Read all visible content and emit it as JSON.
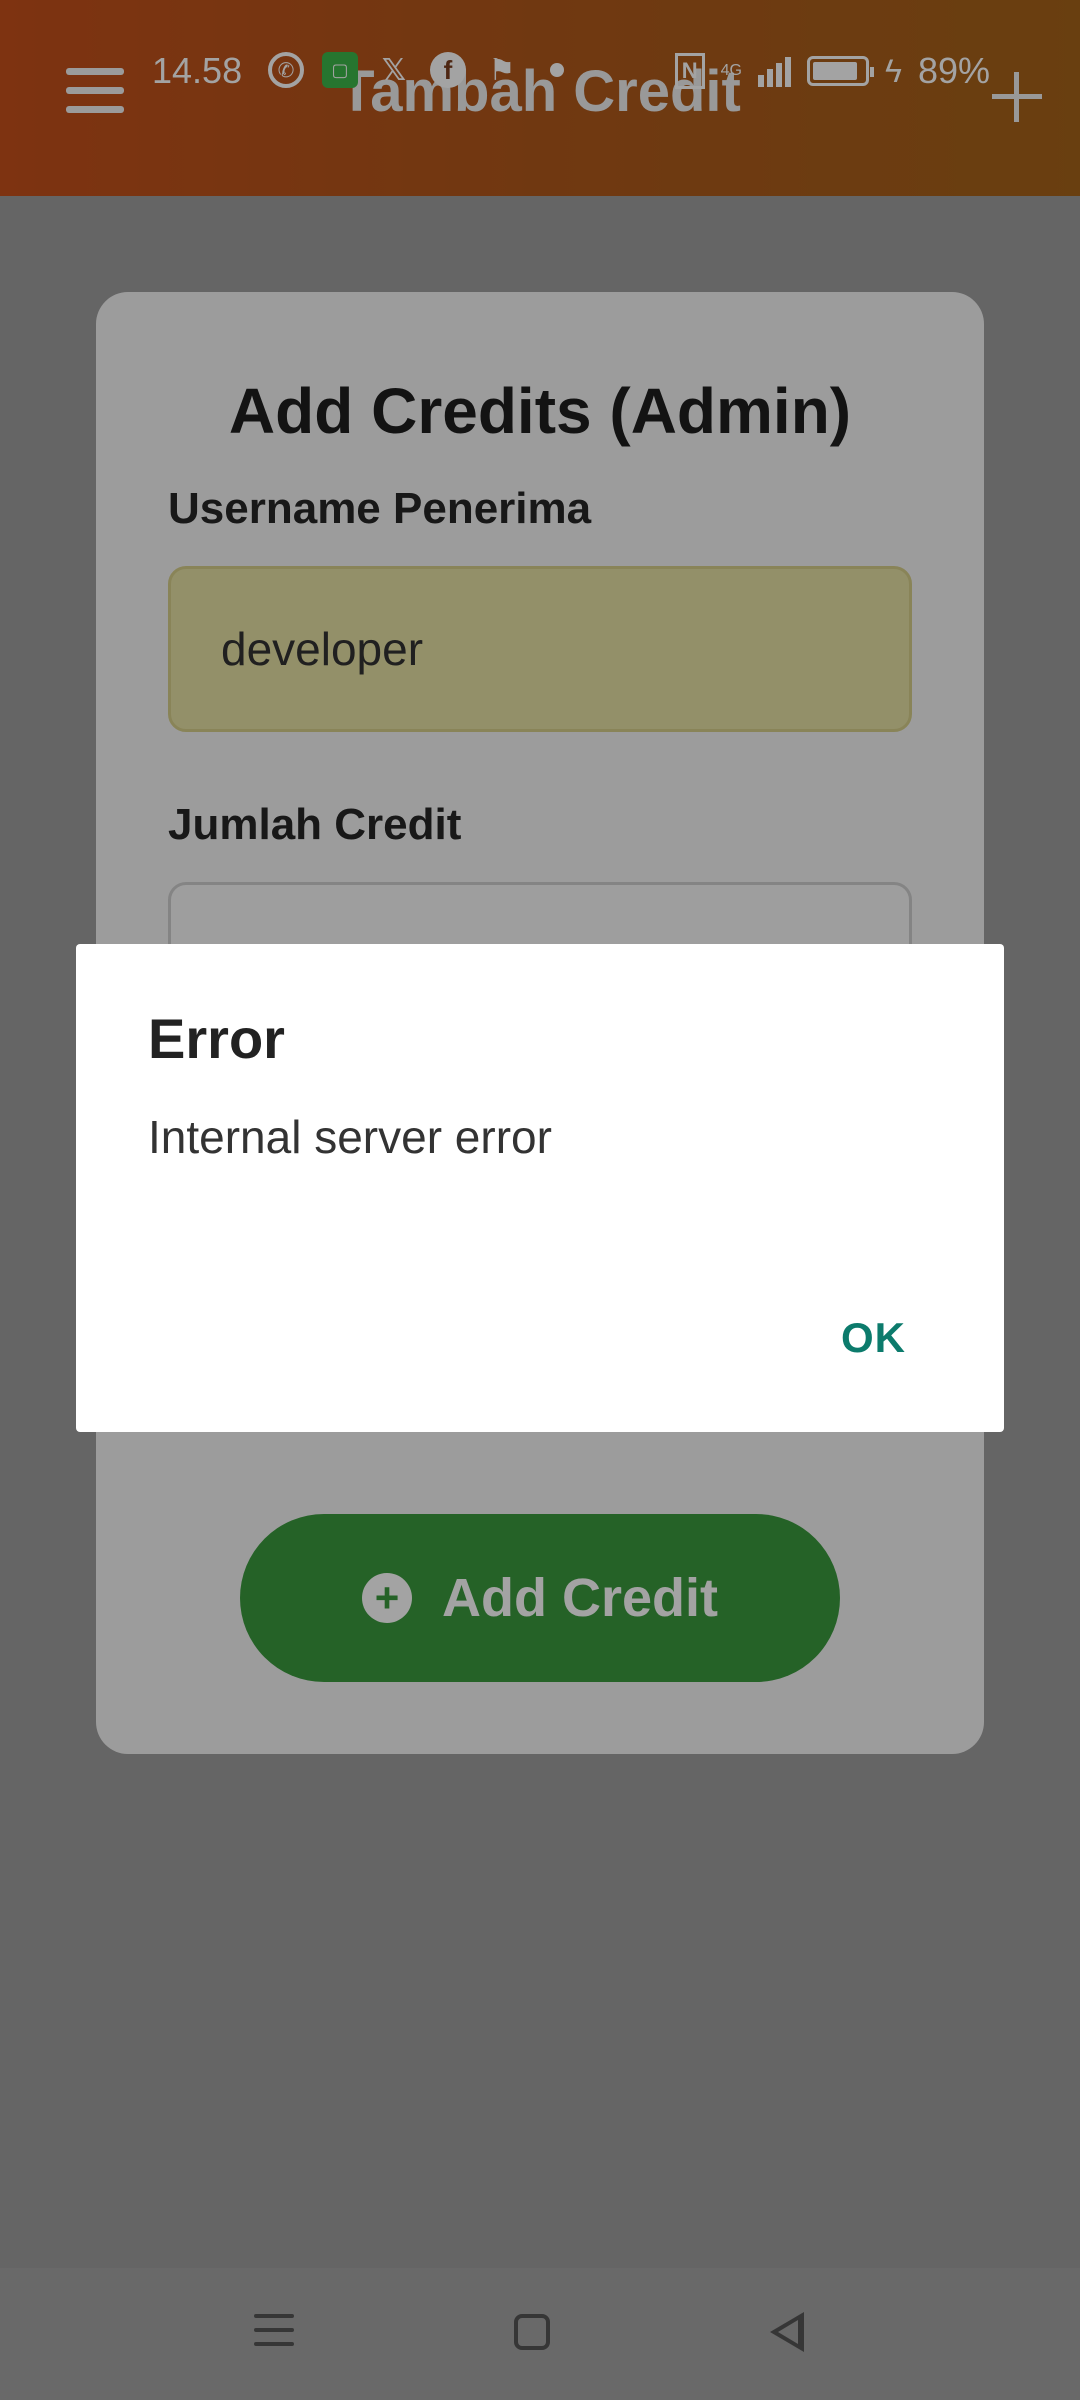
{
  "status_bar": {
    "time": "14.58",
    "battery": "89%",
    "network": "4G",
    "notification_icons": [
      "whatsapp-icon",
      "app-icon",
      "x-icon",
      "facebook-icon",
      "app-icon-2",
      "dot-icon"
    ]
  },
  "app_bar": {
    "title": "Tambah Credit",
    "menu_icon": "hamburger-menu-icon",
    "action_icon": "plus-icon"
  },
  "form": {
    "title": "Add Credits (Admin)",
    "username_label": "Username Penerima",
    "username_value": "developer",
    "amount_label": "Jumlah Credit",
    "amount_value": "",
    "submit_label": "Add Credit"
  },
  "dialog": {
    "title": "Error",
    "message": "Internal server error",
    "ok_label": "OK"
  },
  "colors": {
    "app_bar": "#c5501c",
    "button": "#3a9a3e",
    "dialog_action": "#0c7b6c"
  }
}
